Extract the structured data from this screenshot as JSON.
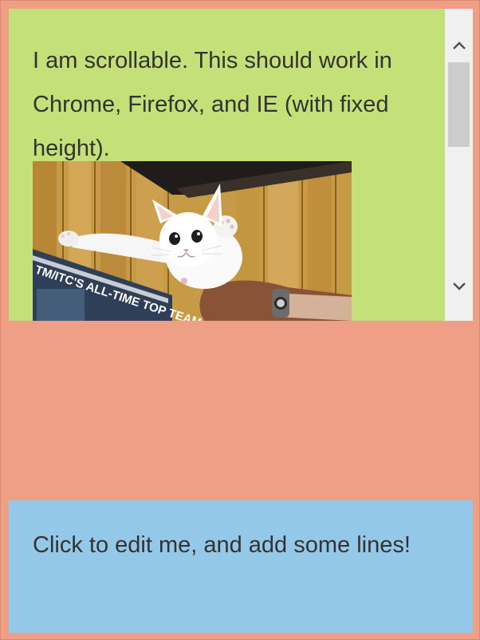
{
  "scroll_panel": {
    "text": "I am scrollable. This should work in Chrome, Firefox, and IE (with fixed height).",
    "image": {
      "description": "white-cat-photo",
      "poster_text": "TM/ITC'S ALL-TIME TOP TEAM"
    },
    "scrollbar": {
      "up_icon": "chevron-up-icon",
      "down_icon": "chevron-down-icon"
    }
  },
  "edit_panel": {
    "text": "Click to edit me, and add some lines!"
  },
  "colors": {
    "background": "#ee9f85",
    "scroll_panel": "#c4e078",
    "edit_panel": "#93c8e8",
    "text": "#333333",
    "scrollbar_track": "#f0f0f0",
    "scrollbar_thumb": "#cdcdcd"
  }
}
